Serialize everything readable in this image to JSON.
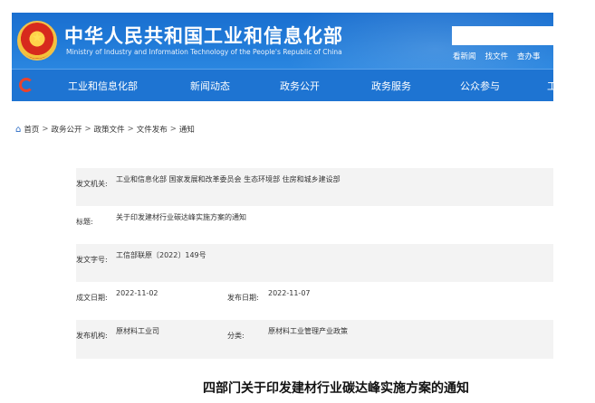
{
  "header": {
    "title": "中华人民共和国工业和信息化部",
    "subtitle": "Ministry of Industry and Information Technology of the People's Republic of China",
    "search_placeholder": "",
    "links": [
      "看新闻",
      "找文件",
      "查办事"
    ]
  },
  "nav": {
    "items": [
      "工业和信息化部",
      "新闻动态",
      "政务公开",
      "政务服务",
      "公众参与",
      "工"
    ]
  },
  "breadcrumb": [
    "首页",
    "政务公开",
    "政策文件",
    "文件发布",
    "通知"
  ],
  "info": {
    "issuer_label": "发文机关:",
    "issuer_value": "工业和信息化部 国家发展和改革委员会 生态环境部 住房和城乡建设部",
    "title_label": "标题:",
    "title_value": "关于印发建材行业碳达峰实施方案的通知",
    "docno_label": "发文字号:",
    "docno_value": "工信部联原〔2022〕149号",
    "created_label": "成文日期:",
    "created_value": "2022-11-02",
    "published_label": "发布日期:",
    "published_value": "2022-11-07",
    "org_label": "发布机构:",
    "org_value": "原材料工业司",
    "category_label": "分类:",
    "category_value": "原材料工业管理产业政策"
  },
  "doc_title": "四部门关于印发建材行业碳达峰实施方案的通知",
  "colors": {
    "header_blue": "#1e74d2",
    "nav_blue": "#1e74d2",
    "row_shade": "#f3f3f3"
  }
}
